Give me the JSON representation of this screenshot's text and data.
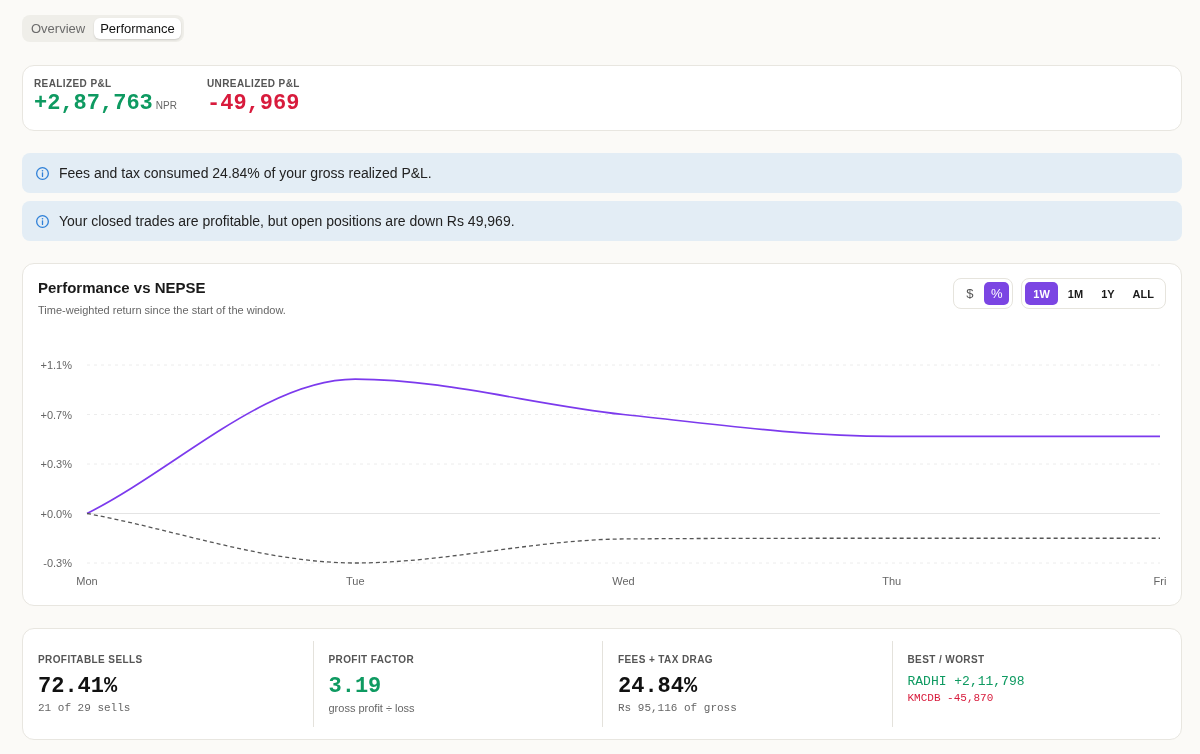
{
  "tabs": [
    {
      "label": "Overview",
      "selected": false
    },
    {
      "label": "Performance",
      "selected": true
    }
  ],
  "pnl_summary": [
    {
      "label": "REALIZED P&L",
      "value": "+2,87,763",
      "unit": "NPR",
      "color": "#0e9a61"
    },
    {
      "label": "UNREALIZED P&L",
      "value": "-49,969",
      "color": "#d81b3c"
    }
  ],
  "notices": [
    "Fees and tax consumed 24.84% of your gross realized P&L.",
    "Your closed trades are profitable, but open positions are down Rs 49,969."
  ],
  "chart_panel": {
    "title": "Performance vs NEPSE",
    "subtitle": "Time-weighted return since the start of the window.",
    "unit_toggle": [
      {
        "label": "$",
        "selected": false
      },
      {
        "label": "%",
        "selected": true
      }
    ],
    "range_toggle": [
      {
        "label": "1W",
        "selected": true
      },
      {
        "label": "1M",
        "selected": false
      },
      {
        "label": "1Y",
        "selected": false
      },
      {
        "label": "ALL",
        "selected": false
      }
    ],
    "chart_data": {
      "type": "line",
      "categories": [
        "Mon",
        "Tue",
        "Wed",
        "Thu",
        "Fri"
      ],
      "series": [
        {
          "color": "#7c3aed",
          "line_style": "solid",
          "values": [
            0,
            0.95,
            0.7,
            0.545,
            0.545
          ]
        },
        {
          "color": "#555555",
          "line_style": "dashed",
          "values": [
            0,
            -0.35,
            -0.18,
            -0.175,
            -0.175
          ]
        }
      ],
      "ylim": [
        -0.35,
        1.05
      ],
      "yticks": [
        {
          "value": 1.05,
          "label": "+1.1%"
        },
        {
          "value": 0.7,
          "label": "+0.7%"
        },
        {
          "value": 0.35,
          "label": "+0.3%"
        },
        {
          "value": 0,
          "label": "+0.0%"
        },
        {
          "value": -0.35,
          "label": "-0.3%"
        }
      ]
    }
  },
  "stats": [
    {
      "kind": "metric",
      "label": "PROFITABLE SELLS",
      "value": "72.41%",
      "color": "#111111",
      "note": "21 of 29 sells"
    },
    {
      "kind": "ratio",
      "label": "PROFIT FACTOR",
      "value": "3.19",
      "color": "#0e9a61",
      "note": "gross profit ÷ loss"
    },
    {
      "kind": "metric",
      "label": "FEES + TAX DRAG",
      "value": "24.84%",
      "color": "#111111",
      "note": "Rs 95,116 of gross"
    },
    {
      "kind": "extremes",
      "label": "BEST / WORST",
      "lines": [
        {
          "text": "RADHI +2,11,798",
          "color": "#0e9a61"
        },
        {
          "text": "KMCDB -45,870",
          "color": "#d81b3c"
        }
      ]
    }
  ]
}
